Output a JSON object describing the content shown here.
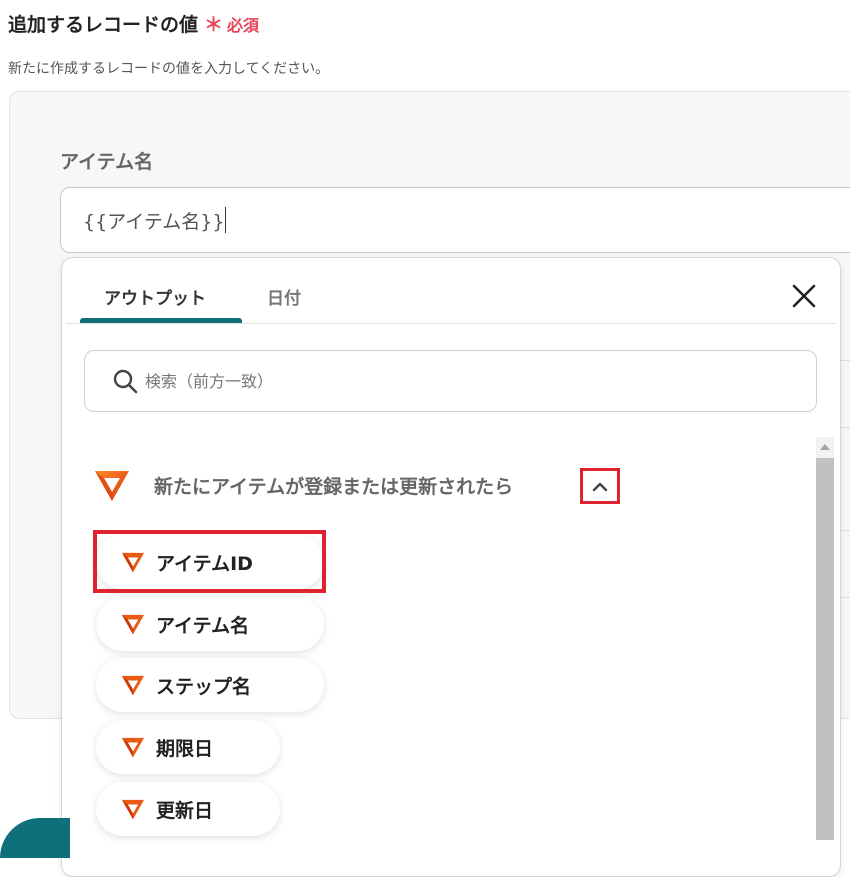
{
  "section": {
    "title": "追加するレコードの値",
    "required_star": "＊",
    "required_label": "必須",
    "description": "新たに作成するレコードの値を入力してください。"
  },
  "field": {
    "label": "アイテム名",
    "value": "{{アイテム名}}"
  },
  "dropdown": {
    "tabs": [
      {
        "label": "アウトプット",
        "active": true
      },
      {
        "label": "日付",
        "active": false
      }
    ],
    "search_placeholder": "検索（前方一致）",
    "group": {
      "title": "新たにアイテムが登録または更新されたら",
      "expanded": true,
      "logo_icon": "app-logo-icon"
    },
    "items": [
      {
        "label": "アイテムID",
        "highlighted": true
      },
      {
        "label": "アイテム名",
        "highlighted": false
      },
      {
        "label": "ステップ名",
        "highlighted": false
      },
      {
        "label": "期限日",
        "highlighted": false
      },
      {
        "label": "更新日",
        "highlighted": false
      }
    ]
  },
  "colors": {
    "accent": "#0f6f7a",
    "required": "#e8455b",
    "highlight": "#e0212f",
    "logo_orange": "#f06a1c"
  }
}
